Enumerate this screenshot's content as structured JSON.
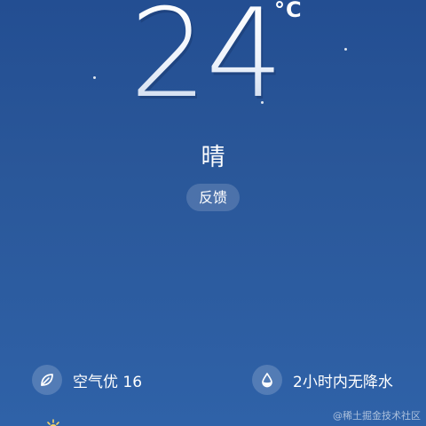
{
  "weather": {
    "temperature": "24",
    "unit": "°C",
    "condition": "晴",
    "feedback_label": "反馈"
  },
  "info": {
    "air_quality": "空气优 16",
    "precipitation": "2小时内无降水"
  },
  "icons": {
    "air_quality": "leaf-icon",
    "precipitation": "water-drop-icon"
  },
  "watermark": "@稀土掘金技术社区",
  "colors": {
    "background_top": "#234e92",
    "background_bottom": "#2f62a8",
    "text": "#ffffff"
  }
}
